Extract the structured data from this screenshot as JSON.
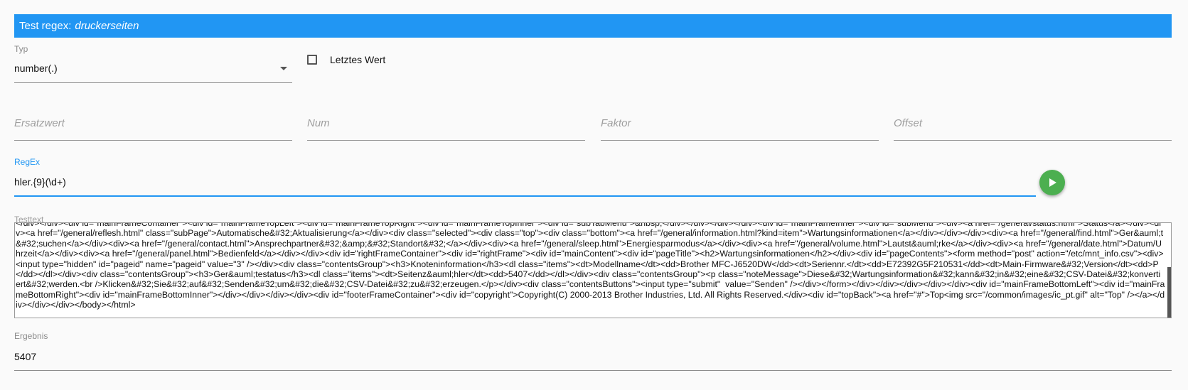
{
  "header": {
    "prefix": "Test regex:",
    "name": "druckerseiten"
  },
  "typ": {
    "label": "Typ",
    "value": "number(.)"
  },
  "last_value": {
    "label": "Letztes Wert",
    "checked": false
  },
  "ersatzwert": {
    "placeholder": "Ersatzwert"
  },
  "num": {
    "placeholder": "Num"
  },
  "faktor": {
    "placeholder": "Faktor"
  },
  "offset": {
    "placeholder": "Offset"
  },
  "regex": {
    "label": "RegEx",
    "value": "hler.{9}(\\d+)"
  },
  "testtext": {
    "label": "Testtext",
    "value": "</div></div><div id=\"mainFrameContainer\"><div id=\"mainFrameTopLeft\"><div id=\"mainFrameTopRight\"><div id=\"mainFrameTopInner\"><div id=\"subTabMenu\">&nbsp;</div></div></div></div><div id=\"mainFrameInner\"><div id=\"subMenu\"><div><a href=\"/general/status.html\">Status</a></div><div><a href=\"/general/reflesh.html\" class=\"subPage\">Automatische&#32;Aktualisierung</a></div><div class=\"selected\"><div class=\"top\"><div class=\"bottom\"><a href=\"/general/information.html?kind=item\">Wartungsinformationen</a></div></div></div><div><a href=\"/general/find.html\">Ger&auml;t&#32;suchen</a></div><div><a href=\"/general/contact.html\">Ansprechpartner&#32;&amp;&#32;Standort&#32;</a></div><div><a href=\"/general/sleep.html\">Energiesparmodus</a></div><div><a href=\"/general/volume.html\">Lautst&auml;rke</a></div><div><a href=\"/general/date.html\">Datum/Uhrzeit</a></div><div><a href=\"/general/panel.html\">Bedienfeld</a></div></div><div id=\"rightFrameContainer\"><div id=\"rightFrame\"><div id=\"mainContent\"><div id=\"pageTitle\"><h2>Wartungsinformationen</h2></div><div id=\"pageContents\"><form method=\"post\" action=\"/etc/mnt_info.csv\"><div><input type=\"hidden\" id=\"pageid\" name=\"pageid\" value=\"3\" /></div><div class=\"contentsGroup\"><h3>Knoteninformation</h3><dl class=\"items\"><dt>Modellname</dt><dd>Brother MFC-J6520DW</dd><dt>Seriennr.</dt><dd>E72392G5F210531</dd><dt>Main-Firmware&#32;Version</dt><dd>P</dd></dl></div><div class=\"contentsGroup\"><h3>Ger&auml;testatus</h3><dl class=\"items\"><dt>Seitenz&auml;hler</dt><dd>5407</dd></dl></div><div class=\"contentsGroup\"><p class=\"noteMessage\">Diese&#32;Wartungsinformation&#32;kann&#32;in&#32;eine&#32;CSV-Datei&#32;konvertiert&#32;werden.<br />Klicken&#32;Sie&#32;auf&#32;Senden&#32;um&#32;die&#32;CSV-Datei&#32;zu&#32;erzeugen.</p></div><div class=\"contentsButtons\"><input type=\"submit\"  value=\"Senden\" /></div></form></div></div></div></div></div><div id=\"mainFrameBottomLeft\"><div id=\"mainFrameBottomRight\"><div id=\"mainFrameBottomInner\"></div></div></div></div><div id=\"footerFrameContainer\"><div id=\"copyright\">Copyright(C) 2000-2013 Brother Industries, Ltd. All Rights Reserved.</div><div id=\"topBack\"><a href=\"#\">Top<img src=\"/common/images/ic_pt.gif\" alt=\"Top\" /></a></div></div></div></body></html>"
  },
  "ergebnis": {
    "label": "Ergebnis",
    "value": "5407"
  },
  "colors": {
    "header": "#2196f3",
    "run_button": "#4caf50",
    "focus_line": "#2196f3"
  },
  "icons": {
    "run": "play-icon",
    "dropdown": "dropdown-arrow-icon"
  }
}
